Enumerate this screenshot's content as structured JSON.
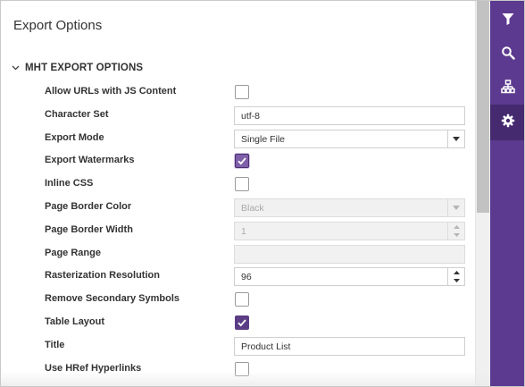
{
  "panel": {
    "title": "Export Options"
  },
  "section": {
    "title": "MHT EXPORT OPTIONS"
  },
  "rows": {
    "allow_urls_js": {
      "label": "Allow URLs with JS Content",
      "checked": false
    },
    "character_set": {
      "label": "Character Set",
      "value": "utf-8"
    },
    "export_mode": {
      "label": "Export Mode",
      "value": "Single File"
    },
    "export_watermarks": {
      "label": "Export Watermarks",
      "checked": true
    },
    "inline_css": {
      "label": "Inline CSS",
      "checked": false
    },
    "page_border_color": {
      "label": "Page Border Color",
      "value": "Black"
    },
    "page_border_width": {
      "label": "Page Border Width",
      "value": "1"
    },
    "page_range": {
      "label": "Page Range",
      "value": ""
    },
    "rasterization_resolution": {
      "label": "Rasterization Resolution",
      "value": "96"
    },
    "remove_secondary_symbols": {
      "label": "Remove Secondary Symbols",
      "checked": false
    },
    "table_layout": {
      "label": "Table Layout",
      "checked": true
    },
    "title": {
      "label": "Title",
      "value": "Product List"
    },
    "use_href_hyperlinks": {
      "label": "Use HRef Hyperlinks",
      "checked": false
    }
  },
  "toolbar": {
    "items": [
      "filter-icon",
      "search-icon",
      "hierarchy-icon",
      "gear-icon"
    ],
    "active": "gear-icon"
  },
  "colors": {
    "accent": "#5c3a8f",
    "accent_dark": "#452a6f",
    "checkbox_checked": "#5b3d86"
  }
}
